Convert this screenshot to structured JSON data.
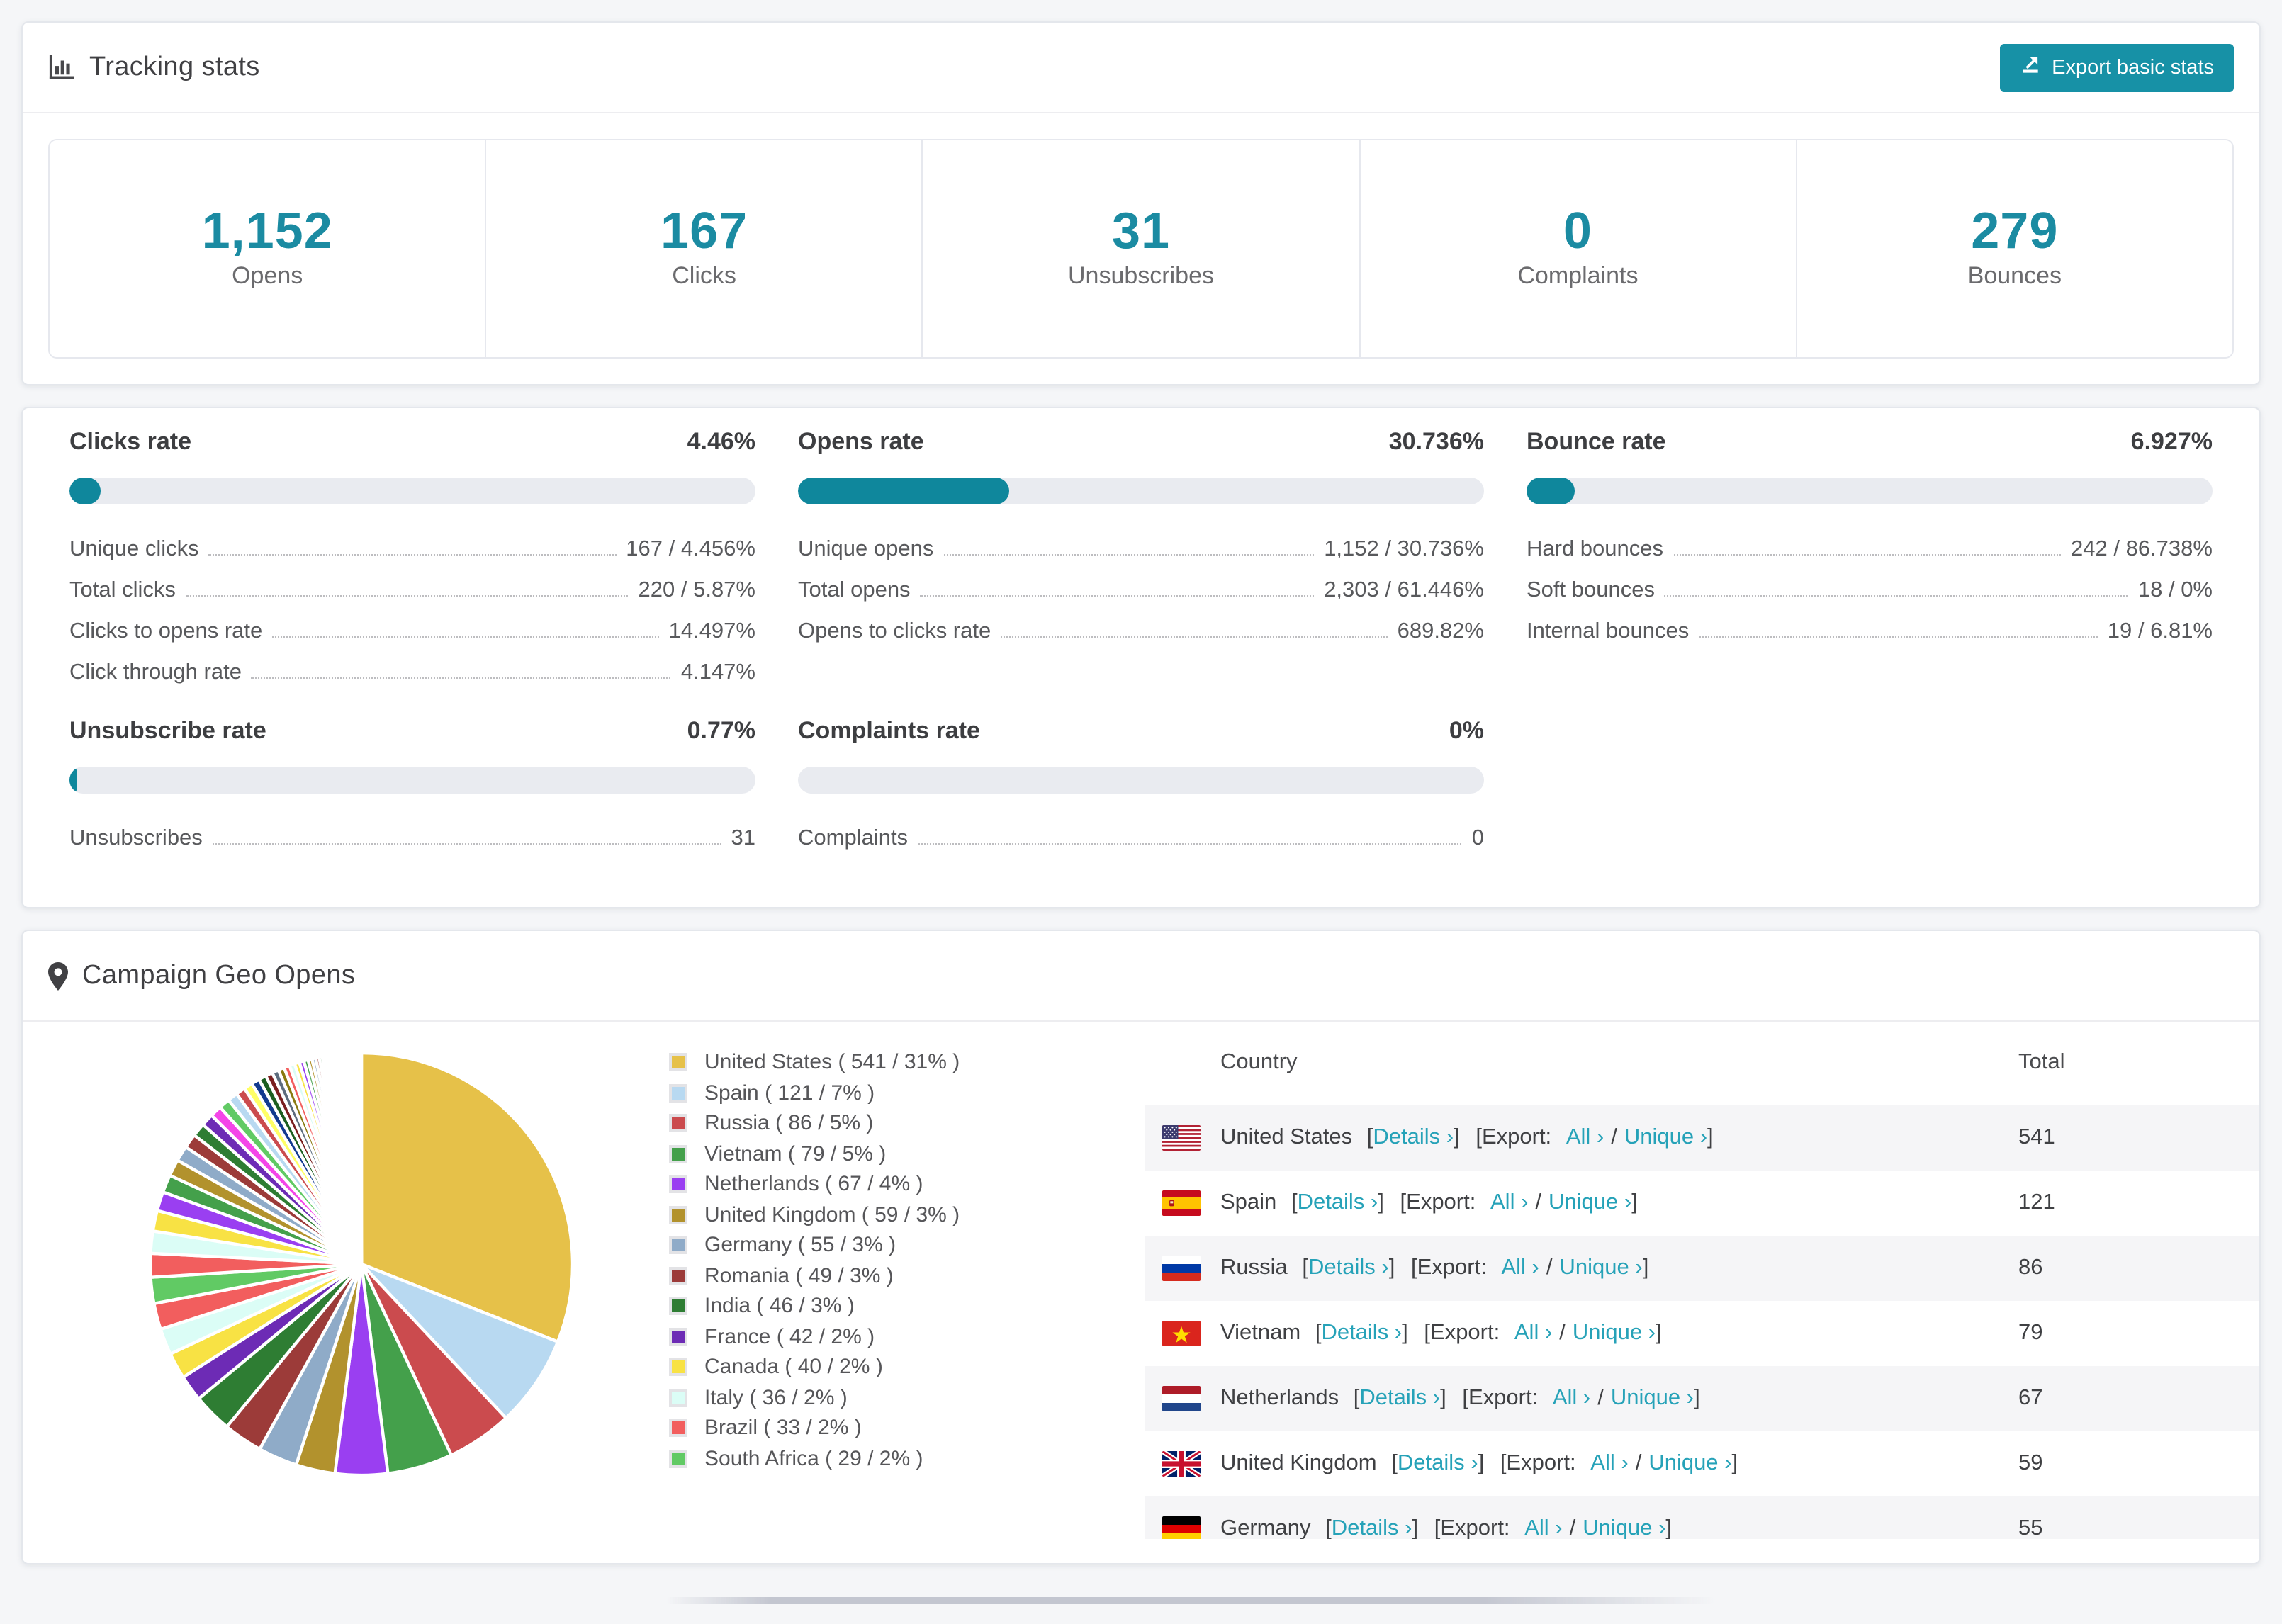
{
  "tracking": {
    "title": "Tracking stats",
    "export_label": "Export basic stats",
    "stats": [
      {
        "value": "1,152",
        "label": "Opens"
      },
      {
        "value": "167",
        "label": "Clicks"
      },
      {
        "value": "31",
        "label": "Unsubscribes"
      },
      {
        "value": "0",
        "label": "Complaints"
      },
      {
        "value": "279",
        "label": "Bounces"
      }
    ]
  },
  "rates": {
    "blocks": [
      {
        "title": "Clicks rate",
        "value_label": "4.46%",
        "bar_pct": 4.46,
        "rows": [
          {
            "label": "Unique clicks",
            "value": "167 / 4.456%"
          },
          {
            "label": "Total clicks",
            "value": "220 / 5.87%"
          },
          {
            "label": "Clicks to opens rate",
            "value": "14.497%"
          },
          {
            "label": "Click through rate",
            "value": "4.147%"
          }
        ]
      },
      {
        "title": "Opens rate",
        "value_label": "30.736%",
        "bar_pct": 30.736,
        "rows": [
          {
            "label": "Unique opens",
            "value": "1,152 / 30.736%"
          },
          {
            "label": "Total opens",
            "value": "2,303 / 61.446%"
          },
          {
            "label": "Opens to clicks rate",
            "value": "689.82%"
          }
        ]
      },
      {
        "title": "Bounce rate",
        "value_label": "6.927%",
        "bar_pct": 6.927,
        "rows": [
          {
            "label": "Hard bounces",
            "value": "242 / 86.738%"
          },
          {
            "label": "Soft bounces",
            "value": "18 / 0%"
          },
          {
            "label": "Internal bounces",
            "value": "19 / 6.81%"
          }
        ]
      },
      {
        "title": "Unsubscribe rate",
        "value_label": "0.77%",
        "bar_pct": 0.77,
        "rows": [
          {
            "label": "Unsubscribes",
            "value": "31"
          }
        ]
      },
      {
        "title": "Complaints rate",
        "value_label": "0%",
        "bar_pct": 0,
        "rows": [
          {
            "label": "Complaints",
            "value": "0"
          }
        ]
      }
    ]
  },
  "geo": {
    "title": "Campaign Geo Opens",
    "table": {
      "col_country": "Country",
      "col_total": "Total",
      "rows": [
        {
          "flag": "us",
          "country": "United States",
          "total": "541"
        },
        {
          "flag": "es",
          "country": "Spain",
          "total": "121"
        },
        {
          "flag": "ru",
          "country": "Russia",
          "total": "86"
        },
        {
          "flag": "vn",
          "country": "Vietnam",
          "total": "79"
        },
        {
          "flag": "nl",
          "country": "Netherlands",
          "total": "67"
        },
        {
          "flag": "gb",
          "country": "United Kingdom",
          "total": "59"
        },
        {
          "flag": "de",
          "country": "Germany",
          "total": "55"
        }
      ]
    },
    "links": {
      "bracket_open": "[",
      "details": "Details ›",
      "bracket_close": "]",
      "export_open": "[Export:",
      "all": "All ›",
      "slash": "/",
      "unique": "Unique ›",
      "bracket_close2": "]"
    }
  },
  "chart_data": {
    "type": "pie",
    "title": "Campaign Geo Opens",
    "unit": "opens",
    "legend_position": "right",
    "start_angle_deg": -90,
    "direction": "clockwise",
    "slices": [
      {
        "label": "United States",
        "value": 541,
        "pct": 31,
        "color": "#e6c149"
      },
      {
        "label": "Spain",
        "value": 121,
        "pct": 7,
        "color": "#b8d9f1"
      },
      {
        "label": "Russia",
        "value": 86,
        "pct": 5,
        "color": "#cb4b4e"
      },
      {
        "label": "Vietnam",
        "value": 79,
        "pct": 5,
        "color": "#44a04b"
      },
      {
        "label": "Netherlands",
        "value": 67,
        "pct": 4,
        "color": "#9a3ff1"
      },
      {
        "label": "United Kingdom",
        "value": 59,
        "pct": 3,
        "color": "#b2922d"
      },
      {
        "label": "Germany",
        "value": 55,
        "pct": 3,
        "color": "#8fabc8"
      },
      {
        "label": "Romania",
        "value": 49,
        "pct": 3,
        "color": "#9c3b39"
      },
      {
        "label": "India",
        "value": 46,
        "pct": 3,
        "color": "#2e7d33"
      },
      {
        "label": "France",
        "value": 42,
        "pct": 2,
        "color": "#6d2bb5"
      },
      {
        "label": "Canada",
        "value": 40,
        "pct": 2,
        "color": "#f8e244"
      },
      {
        "label": "Italy",
        "value": 36,
        "pct": 2,
        "color": "#dbfdf6"
      },
      {
        "label": "Brazil",
        "value": 33,
        "pct": 2,
        "color": "#f25e5e"
      },
      {
        "label": "South Africa",
        "value": 29,
        "pct": 2,
        "color": "#61ca64"
      }
    ],
    "others_pct": 26,
    "tail_colors": [
      "#f25e5e",
      "#dbfdf6",
      "#f8e244",
      "#9a3ff1",
      "#44a04b",
      "#b2922d",
      "#8fabc8",
      "#9c3b39",
      "#2e7d33",
      "#6d2bb5",
      "#f445e8",
      "#61ca64",
      "#b8d9f1",
      "#cb4b4e",
      "#ffff66",
      "#123a8f",
      "#1b5e20",
      "#7a1f1f",
      "#5d6d7e",
      "#8a7a10"
    ]
  },
  "colors": {
    "accent_teal": "#1b8ba2",
    "bar_fill": "#0f879c",
    "button_bg": "#1791a6",
    "link_teal": "#26a2b8",
    "row_stripe": "#f5f5f7"
  }
}
